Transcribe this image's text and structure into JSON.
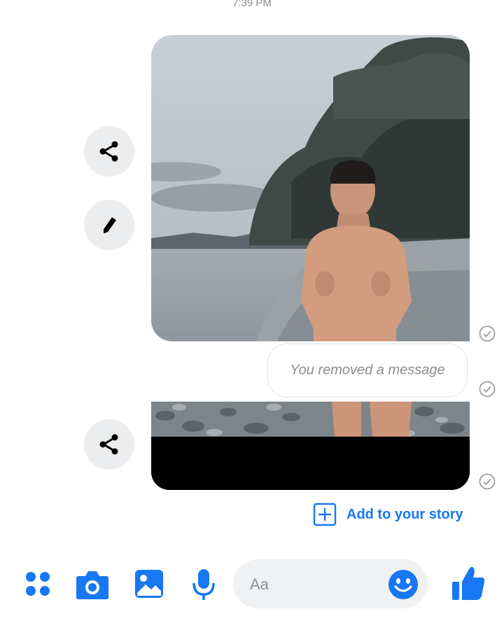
{
  "header": {
    "timestamp": "7:39 PM"
  },
  "actions": {
    "share_icon": "share-icon",
    "edit_icon": "pencil-icon"
  },
  "messages": {
    "removed_text": "You removed a message",
    "status_icon": "sent-check-icon"
  },
  "story": {
    "label": "Add to your story",
    "icon": "plus-square-icon"
  },
  "composer": {
    "placeholder": "Aa",
    "icons": [
      "menu-dots-icon",
      "camera-icon",
      "image-icon",
      "microphone-icon",
      "emoji-icon",
      "thumbs-up-icon"
    ]
  },
  "colors": {
    "accent": "#1877f2",
    "bubble_border": "#dfe1e4",
    "muted_text": "#8a8d91",
    "button_bg": "#ecedef",
    "composer_bg": "#f0f1f3"
  }
}
